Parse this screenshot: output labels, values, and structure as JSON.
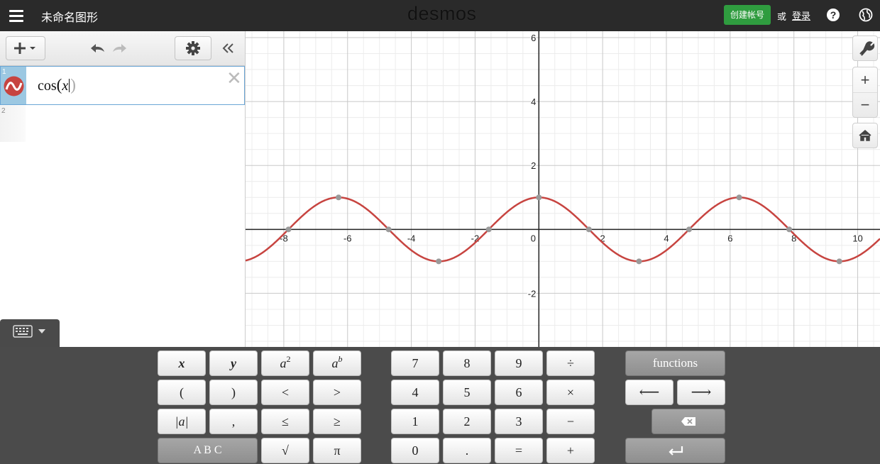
{
  "topbar": {
    "title": "未命名图形",
    "logo": "desmos",
    "signup_label": "创建帐号",
    "or_text": "或",
    "login_label": "登录",
    "icons": [
      "menu-icon",
      "help-icon",
      "globe-icon"
    ]
  },
  "sidebar": {
    "toolbar": {
      "add_label": "+",
      "icons": [
        "add-item-icon",
        "undo-icon",
        "redo-icon",
        "settings-icon",
        "collapse-icon"
      ]
    },
    "expressions": [
      {
        "index": "1",
        "func": "cos",
        "open": "(",
        "arg": "x",
        "close": ")",
        "color": "#c74440"
      },
      {
        "index": "2"
      }
    ],
    "delete_symbol": "✕"
  },
  "graph": {
    "function": "cos(x)",
    "curve_color": "#c74440",
    "xlim": [
      -9.2,
      10.7
    ],
    "ylim": [
      -3.7,
      6.2
    ],
    "x_ticks": [
      "-8",
      "-6",
      "-4",
      "-2",
      "0",
      "2",
      "4",
      "6",
      "8",
      "10"
    ],
    "y_ticks": [
      "6",
      "4",
      "2",
      "-2"
    ],
    "right_controls": {
      "zoom_in": "+",
      "zoom_out": "−",
      "icons": [
        "wrench-icon",
        "home-icon"
      ]
    }
  },
  "keypad": {
    "left_keys": [
      [
        "x",
        "y",
        "a²",
        "aᵇ"
      ],
      [
        "(",
        ")",
        "<",
        ">"
      ],
      [
        "|a|",
        ",",
        "≤",
        "≥"
      ],
      [
        "A B C",
        "√",
        "π"
      ]
    ],
    "left_labels": {
      "x": "x",
      "y": "y",
      "a": "a",
      "sq": "2",
      "b": "b",
      "lparen": "(",
      "rparen": ")",
      "lt": "<",
      "gt": ">",
      "abs": "|a|",
      "comma": ",",
      "le": "≤",
      "ge": "≥",
      "abc": "A B C",
      "sqrt": "√",
      "pi": "π"
    },
    "number_keys": {
      "k7": "7",
      "k8": "8",
      "k9": "9",
      "div": "÷",
      "k4": "4",
      "k5": "5",
      "k6": "6",
      "mul": "×",
      "k1": "1",
      "k2": "2",
      "k3": "3",
      "minus": "−",
      "k0": "0",
      "dot": ".",
      "eq": "=",
      "plus": "+"
    },
    "right_keys": {
      "functions": "functions",
      "left_arrow": "⟵",
      "right_arrow": "⟶",
      "icons": [
        "backspace-icon",
        "enter-icon"
      ]
    },
    "keyboard_toggle_icons": [
      "keyboard-icon",
      "caret-down-icon"
    ]
  }
}
